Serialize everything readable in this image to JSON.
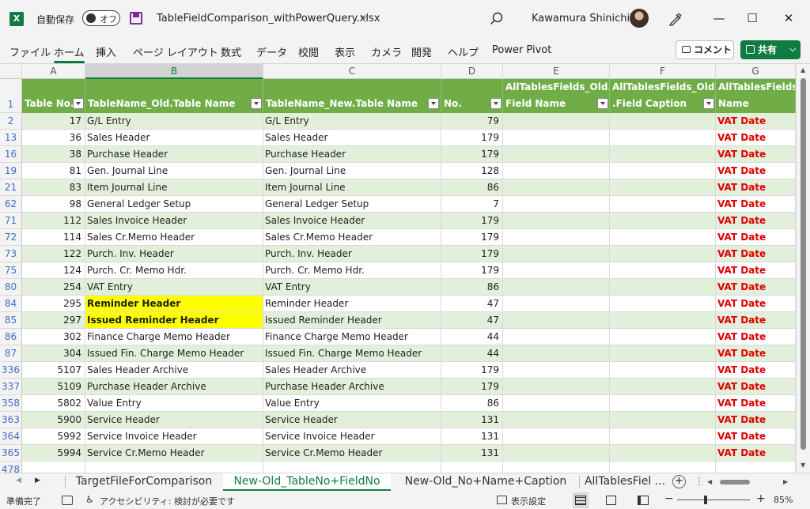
{
  "titlebar": {
    "app_icon": "X",
    "autosave_label": "自動保存",
    "autosave_state": "オフ",
    "filename": "TableFieldComparison_withPowerQuery.xlsx",
    "user_name": "Kawamura Shinichi"
  },
  "menu": {
    "items": [
      "ファイル",
      "ホーム",
      "挿入",
      "ページ レイアウト",
      "数式",
      "データ",
      "校閲",
      "表示",
      "カメラ",
      "開発",
      "ヘルプ",
      "Power Pivot"
    ],
    "active": "ホーム",
    "comment_label": "コメント",
    "share_label": "共有"
  },
  "columns": [
    "A",
    "B",
    "C",
    "D",
    "E",
    "F",
    "G"
  ],
  "selected_column": "B",
  "header_row_number": "1",
  "headers": {
    "a": "Table No.",
    "b": "TableName_Old.Table Name",
    "c": "TableName_New.Table Name",
    "d": "No.",
    "e1": "AllTablesFields_Old.",
    "e2": "Field Name",
    "f1": "AllTablesFields_Old",
    "f2": ".Field Caption",
    "g1": "AllTablesFields",
    "g2": "Name"
  },
  "rows": [
    {
      "row": "2",
      "no": "17",
      "old": "G/L Entry",
      "new": "G/L Entry",
      "field": "79",
      "g": "VAT Date",
      "hl": false
    },
    {
      "row": "13",
      "no": "36",
      "old": "Sales Header",
      "new": "Sales Header",
      "field": "179",
      "g": "VAT Date",
      "hl": false
    },
    {
      "row": "16",
      "no": "38",
      "old": "Purchase Header",
      "new": "Purchase Header",
      "field": "179",
      "g": "VAT Date",
      "hl": false
    },
    {
      "row": "19",
      "no": "81",
      "old": "Gen. Journal Line",
      "new": "Gen. Journal Line",
      "field": "128",
      "g": "VAT Date",
      "hl": false
    },
    {
      "row": "21",
      "no": "83",
      "old": "Item Journal Line",
      "new": "Item Journal Line",
      "field": "86",
      "g": "VAT Date",
      "hl": false
    },
    {
      "row": "62",
      "no": "98",
      "old": "General Ledger Setup",
      "new": "General Ledger Setup",
      "field": "7",
      "g": "VAT Date",
      "hl": false
    },
    {
      "row": "71",
      "no": "112",
      "old": "Sales Invoice Header",
      "new": "Sales Invoice Header",
      "field": "179",
      "g": "VAT Date",
      "hl": false
    },
    {
      "row": "72",
      "no": "114",
      "old": "Sales Cr.Memo Header",
      "new": "Sales Cr.Memo Header",
      "field": "179",
      "g": "VAT Date",
      "hl": false
    },
    {
      "row": "73",
      "no": "122",
      "old": "Purch. Inv. Header",
      "new": "Purch. Inv. Header",
      "field": "179",
      "g": "VAT Date",
      "hl": false
    },
    {
      "row": "75",
      "no": "124",
      "old": "Purch. Cr. Memo Hdr.",
      "new": "Purch. Cr. Memo Hdr.",
      "field": "179",
      "g": "VAT Date",
      "hl": false
    },
    {
      "row": "80",
      "no": "254",
      "old": "VAT Entry",
      "new": "VAT Entry",
      "field": "86",
      "g": "VAT Date",
      "hl": false
    },
    {
      "row": "84",
      "no": "295",
      "old": "Reminder Header",
      "new": "Reminder Header",
      "field": "47",
      "g": "VAT Date",
      "hl": true
    },
    {
      "row": "85",
      "no": "297",
      "old": "Issued Reminder Header",
      "new": "Issued Reminder Header",
      "field": "47",
      "g": "VAT Date",
      "hl": true
    },
    {
      "row": "86",
      "no": "302",
      "old": "Finance Charge Memo Header",
      "new": "Finance Charge Memo Header",
      "field": "44",
      "g": "VAT Date",
      "hl": false
    },
    {
      "row": "87",
      "no": "304",
      "old": "Issued Fin. Charge Memo Header",
      "new": "Issued Fin. Charge Memo Header",
      "field": "44",
      "g": "VAT Date",
      "hl": false
    },
    {
      "row": "336",
      "no": "5107",
      "old": "Sales Header Archive",
      "new": "Sales Header Archive",
      "field": "179",
      "g": "VAT Date",
      "hl": false
    },
    {
      "row": "337",
      "no": "5109",
      "old": "Purchase Header Archive",
      "new": "Purchase Header Archive",
      "field": "179",
      "g": "VAT Date",
      "hl": false
    },
    {
      "row": "358",
      "no": "5802",
      "old": "Value Entry",
      "new": "Value Entry",
      "field": "86",
      "g": "VAT Date",
      "hl": false
    },
    {
      "row": "363",
      "no": "5900",
      "old": "Service Header",
      "new": "Service Header",
      "field": "131",
      "g": "VAT Date",
      "hl": false
    },
    {
      "row": "364",
      "no": "5992",
      "old": "Service Invoice Header",
      "new": "Service Invoice Header",
      "field": "131",
      "g": "VAT Date",
      "hl": false
    },
    {
      "row": "365",
      "no": "5994",
      "old": "Service Cr.Memo Header",
      "new": "Service Cr.Memo Header",
      "field": "131",
      "g": "VAT Date",
      "hl": false
    }
  ],
  "empty_row_number": "478",
  "sheets": {
    "tabs": [
      "TargetFileForComparison",
      "New-Old_TableNo+FieldNo",
      "New-Old_No+Name+Caption",
      "AllTablesFiel ..."
    ],
    "active_index": 1
  },
  "status": {
    "ready": "準備完了",
    "accessibility": "アクセシビリティ: 検討が必要です",
    "display_settings": "表示設定",
    "zoom": "85%"
  },
  "colors": {
    "accent": "#107c41",
    "header_green": "#70ad47",
    "band": "#e2efda",
    "highlight": "#ffff00",
    "vat_red": "#e00000"
  }
}
